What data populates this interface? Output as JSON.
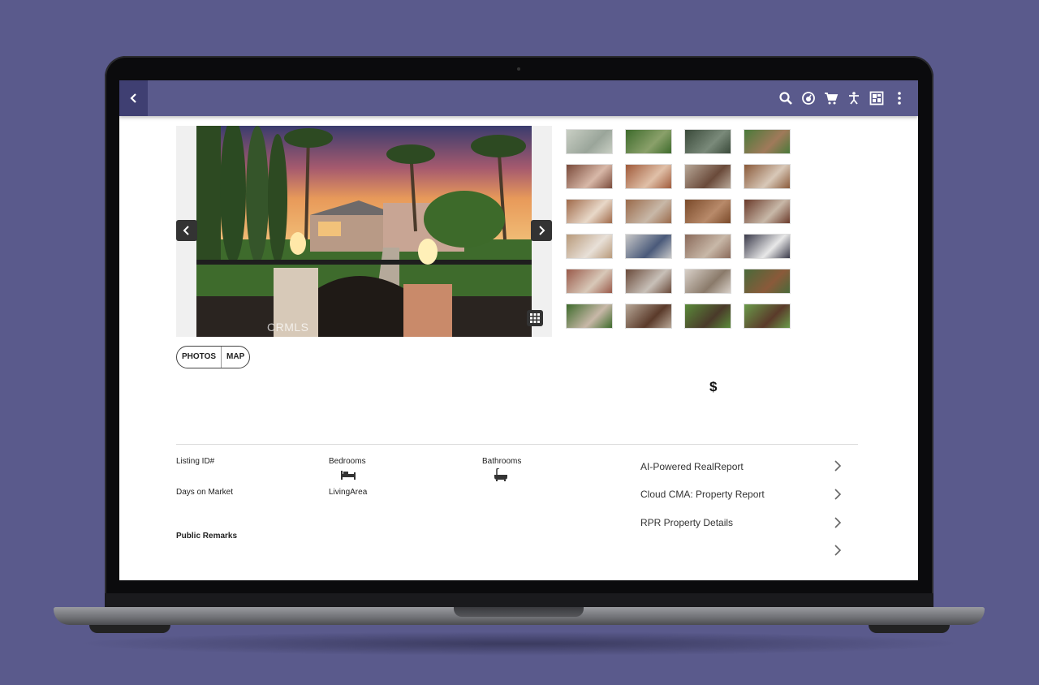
{
  "header": {
    "back_icon": "chevron-left-icon",
    "icons": [
      "search-icon",
      "speedometer-icon",
      "cart-icon",
      "accessibility-icon",
      "dashboard-icon",
      "more-vert-icon"
    ],
    "accent": "#5a5a8c"
  },
  "gallery": {
    "watermark": "CRMLS",
    "thumbnail_count": 24
  },
  "toggle": {
    "photos": "PHOTOS",
    "map": "MAP"
  },
  "price": "$",
  "details": {
    "listing_id_label": "Listing ID#",
    "days_on_market_label": "Days on Market",
    "bedrooms_label": "Bedrooms",
    "living_area_label": "LivingArea",
    "bathrooms_label": "Bathrooms",
    "public_remarks_label": "Public Remarks"
  },
  "links": [
    {
      "label": "AI-Powered RealReport"
    },
    {
      "label": "Cloud CMA: Property Report"
    },
    {
      "label": "RPR Property Details"
    },
    {
      "label": ""
    }
  ]
}
